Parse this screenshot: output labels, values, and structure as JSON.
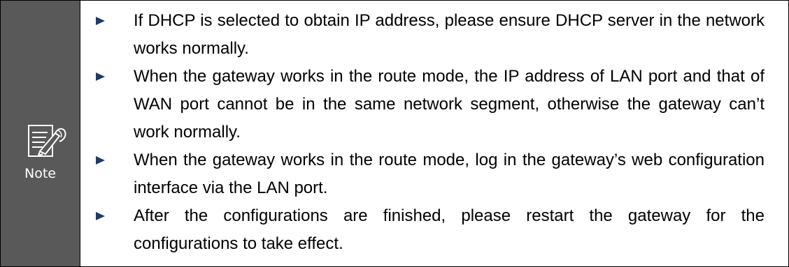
{
  "note": {
    "label": "Note",
    "icon": "note-pen-icon",
    "side_color": "#595959",
    "bullet_color": "#1f3b64",
    "items": [
      {
        "text": "If DHCP is selected to obtain IP address, please ensure DHCP server in the network works normally."
      },
      {
        "text": "When the gateway works in the route mode, the IP address of LAN port and that of WAN port cannot be in the same network segment, otherwise the gateway can’t work normally."
      },
      {
        "text": "When the gateway works in the route mode, log in the gateway’s web configuration interface via the LAN port."
      },
      {
        "text": "After the configurations are finished, please restart the gateway for the configurations to take effect."
      }
    ]
  }
}
